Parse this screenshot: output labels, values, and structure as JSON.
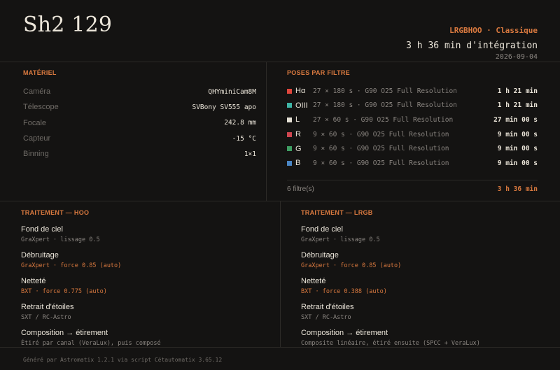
{
  "header": {
    "title": "Sh2 129",
    "preset": "LRGBHOO · Classique",
    "total_integration": "3 h 36 min d'intégration",
    "date": "2026-09-04"
  },
  "materiel": {
    "label": "MATÉRIEL",
    "rows": [
      {
        "key": "Caméra",
        "value": "QHYminiCam8M"
      },
      {
        "key": "Télescope",
        "value": "SVBony SV555 apo"
      },
      {
        "key": "Focale",
        "value": "242.8 mm"
      },
      {
        "key": "Capteur",
        "value": "-15 °C"
      },
      {
        "key": "Binning",
        "value": "1×1"
      }
    ]
  },
  "poses": {
    "label": "POSES PAR FILTRE",
    "rows": [
      {
        "filter": "Hα",
        "color": "#e0473d",
        "detail": "27 × 180 s · G90 O25 Full Resolution",
        "time": "1 h 21 min"
      },
      {
        "filter": "OIII",
        "color": "#3fb5a6",
        "detail": "27 × 180 s · G90 O25 Full Resolution",
        "time": "1 h 21 min"
      },
      {
        "filter": "L",
        "color": "#e6e1d6",
        "detail": "27 × 60 s · G90 O25 Full Resolution",
        "time": "27 min 00 s"
      },
      {
        "filter": "R",
        "color": "#cf4650",
        "detail": "9 × 60 s · G90 O25 Full Resolution",
        "time": "9 min 00 s"
      },
      {
        "filter": "G",
        "color": "#3f9e63",
        "detail": "9 × 60 s · G90 O25 Full Resolution",
        "time": "9 min 00 s"
      },
      {
        "filter": "B",
        "color": "#4a86c5",
        "detail": "9 × 60 s · G90 O25 Full Resolution",
        "time": "9 min 00 s"
      }
    ],
    "count": "6 filtre(s)",
    "total": "3 h 36 min"
  },
  "traitement_hoo": {
    "label": "TRAITEMENT — HOO",
    "steps": [
      {
        "name": "Fond de ciel",
        "detail": "GraXpert · lissage 0.5"
      },
      {
        "name": "Débruitage",
        "detail": "GraXpert · force 0.85 (auto)"
      },
      {
        "name": "Netteté",
        "detail": "BXT · force 0.775 (auto)"
      },
      {
        "name": "Retrait d'étoiles",
        "detail": "SXT / RC-Astro"
      },
      {
        "name": "Composition → étirement",
        "detail": "Étiré par canal (VeraLux), puis composé"
      }
    ]
  },
  "traitement_lrgb": {
    "label": "TRAITEMENT — LRGB",
    "steps": [
      {
        "name": "Fond de ciel",
        "detail": "GraXpert · lissage 0.5"
      },
      {
        "name": "Débruitage",
        "detail": "GraXpert · force 0.85 (auto)"
      },
      {
        "name": "Netteté",
        "detail": "BXT · force 0.388 (auto)"
      },
      {
        "name": "Retrait d'étoiles",
        "detail": "SXT / RC-Astro"
      },
      {
        "name": "Composition → étirement",
        "detail": "Composite linéaire, étiré ensuite (SPCC + VeraLux)"
      }
    ]
  },
  "footer": "Généré par Astromatix 1.2.1 via script Cétautomatix 3.65.12",
  "colors": {
    "accent": "#d9793f",
    "background": "#141312"
  }
}
